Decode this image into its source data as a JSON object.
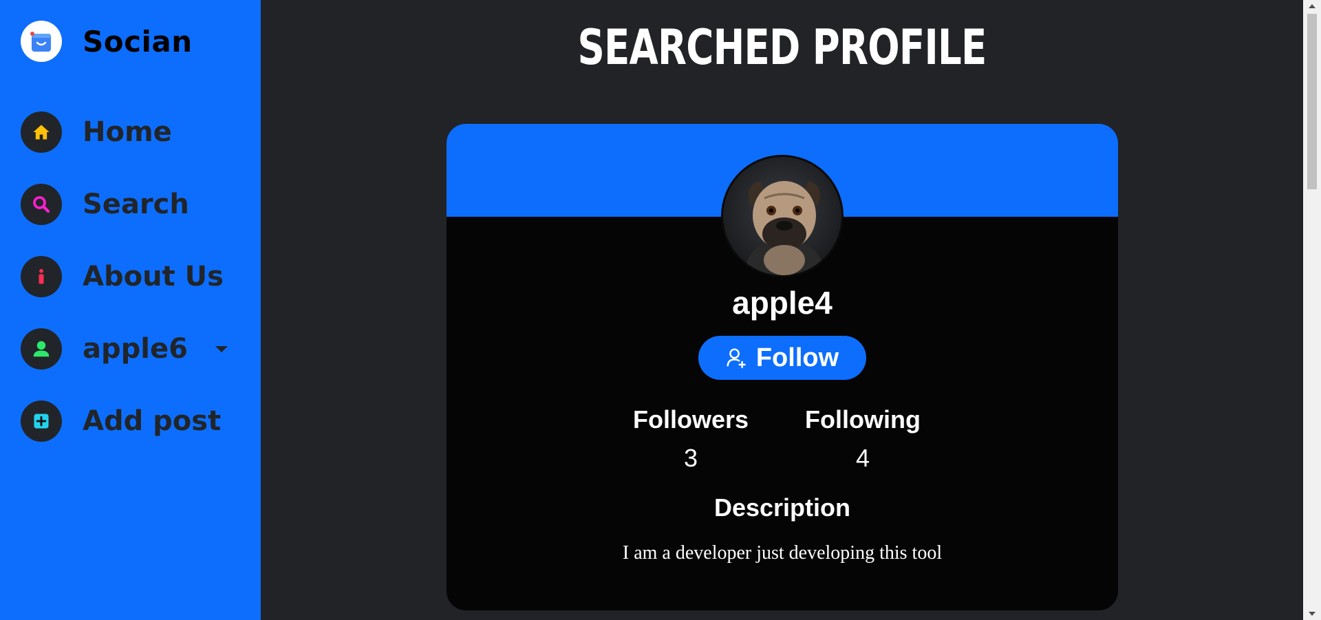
{
  "brand": {
    "name": "Socian",
    "logo_icon": "shopping-bag-icon"
  },
  "nav": {
    "items": [
      {
        "label": "Home",
        "icon": "home-icon",
        "color": "#ffc107"
      },
      {
        "label": "Search",
        "icon": "search-icon",
        "color": "#ff1fd1"
      },
      {
        "label": "About Us",
        "icon": "info-icon",
        "color": "#ff2d55"
      },
      {
        "label": "apple6",
        "icon": "user-icon",
        "color": "#2ee86b",
        "has_dropdown": true
      },
      {
        "label": "Add post",
        "icon": "plus-square-icon",
        "color": "#22d3ee"
      }
    ]
  },
  "main": {
    "title": "SEARCHED PROFILE",
    "profile": {
      "username": "apple4",
      "avatar": "pug-dog-photo",
      "follow_label": "Follow",
      "followers_label": "Followers",
      "followers_count": "3",
      "following_label": "Following",
      "following_count": "4",
      "description_label": "Description",
      "description_text": "I am a developer just developing this tool"
    }
  },
  "colors": {
    "sidebar": "#0d6efd",
    "background": "#212327",
    "card": "#050505",
    "accent": "#0d6efd"
  }
}
